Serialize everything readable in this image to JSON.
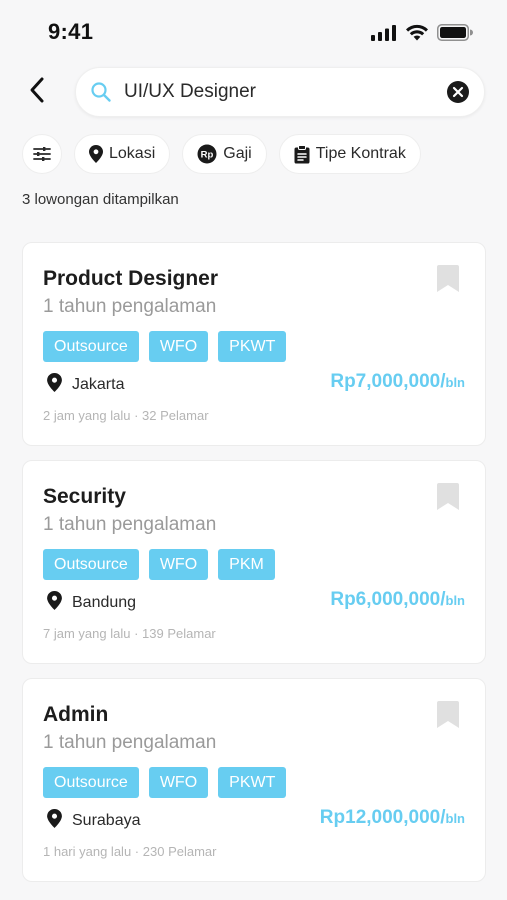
{
  "status_bar": {
    "time": "9:41"
  },
  "search": {
    "value": "UI/UX Designer"
  },
  "filters": [
    {
      "label": "Lokasi",
      "icon": "location-pin-icon"
    },
    {
      "label": "Gaji",
      "icon": "rupiah-icon",
      "icon_text": "Rp"
    },
    {
      "label": "Tipe Kontrak",
      "icon": "clipboard-icon"
    }
  ],
  "result_count": "3 lowongan ditampilkan",
  "colors": {
    "accent": "#67cdf1",
    "muted": "#9a9a9a",
    "background": "#f7f7f8"
  },
  "jobs": [
    {
      "title": "Product Designer",
      "experience": "1 tahun pengalaman",
      "tags": [
        "Outsource",
        "WFO",
        "PKWT"
      ],
      "location": "Jakarta",
      "salary": "Rp7,000,000/",
      "salary_unit": "bln",
      "posted": "2 jam yang lalu",
      "separator": "·",
      "applicants": "32 Pelamar"
    },
    {
      "title": "Security",
      "experience": "1 tahun pengalaman",
      "tags": [
        "Outsource",
        "WFO",
        "PKM"
      ],
      "location": "Bandung",
      "salary": "Rp6,000,000/",
      "salary_unit": "bln",
      "posted": "7 jam yang lalu",
      "separator": "·",
      "applicants": "139 Pelamar"
    },
    {
      "title": "Admin",
      "experience": "1 tahun pengalaman",
      "tags": [
        "Outsource",
        "WFO",
        "PKWT"
      ],
      "location": "Surabaya",
      "salary": "Rp12,000,000/",
      "salary_unit": "bln",
      "posted": "1 hari yang lalu",
      "separator": "·",
      "applicants": "230 Pelamar"
    }
  ]
}
